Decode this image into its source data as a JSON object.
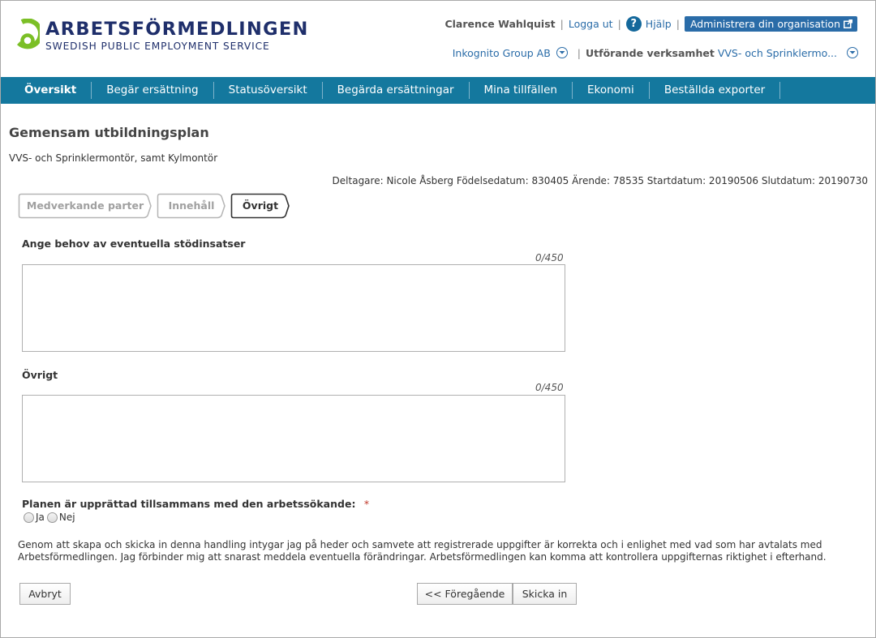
{
  "brand": {
    "name": "ARBETSFÖRMEDLINGEN",
    "subtitle": "SWEDISH PUBLIC EMPLOYMENT SERVICE",
    "logo_color": "#7bbf26",
    "text_color": "#1f2f6b"
  },
  "header": {
    "user_name": "Clarence Wahlquist",
    "sep": "|",
    "logout": "Logga ut",
    "help_icon": "question-circle-icon",
    "help": "Hjälp",
    "admin_button": "Administrera din organisation",
    "organization": "Inkognito Group AB",
    "unit_label": "Utförande verksamhet",
    "unit_value": "VVS- och Sprinklermo..."
  },
  "nav": {
    "items": [
      {
        "label": "Översikt"
      },
      {
        "label": "Begär ersättning"
      },
      {
        "label": "Statusöversikt"
      },
      {
        "label": "Begärda ersättningar"
      },
      {
        "label": "Mina tillfällen"
      },
      {
        "label": "Ekonomi"
      },
      {
        "label": "Beställda exporter"
      }
    ],
    "color": "#14789e"
  },
  "page": {
    "title": "Gemensam utbildningsplan",
    "subtitle": "VVS- och Sprinklermontör, samt Kylmontör",
    "participant_info": "Deltagare: Nicole Åsberg Födelsedatum: 830405 Ärende: 78535 Startdatum: 20190506 Slutdatum: 20190730"
  },
  "steps": [
    {
      "label": "Medverkande parter",
      "active": false
    },
    {
      "label": "Innehåll",
      "active": false
    },
    {
      "label": "Övrigt",
      "active": true
    }
  ],
  "form": {
    "support": {
      "label": "Ange behov av eventuella stödinsatser",
      "counter": "0/450",
      "value": ""
    },
    "other": {
      "label": "Övrigt",
      "counter": "0/450",
      "value": ""
    },
    "plan_question": "Planen är upprättad tillsammans med den arbetssökande:",
    "required_mark": "*",
    "radio_yes": "Ja",
    "radio_no": "Nej"
  },
  "declaration": "Genom att skapa och skicka in denna handling intygar jag på heder och samvete att registrerade uppgifter är korrekta och i enlighet med vad som har avtalats med Arbetsförmedlingen. Jag förbinder mig att snarast meddela eventuella förändringar. Arbetsförmedlingen kan komma att kontrollera uppgifternas riktighet i efterhand.",
  "buttons": {
    "cancel": "Avbryt",
    "previous": "<< Föregående",
    "submit": "Skicka in"
  }
}
